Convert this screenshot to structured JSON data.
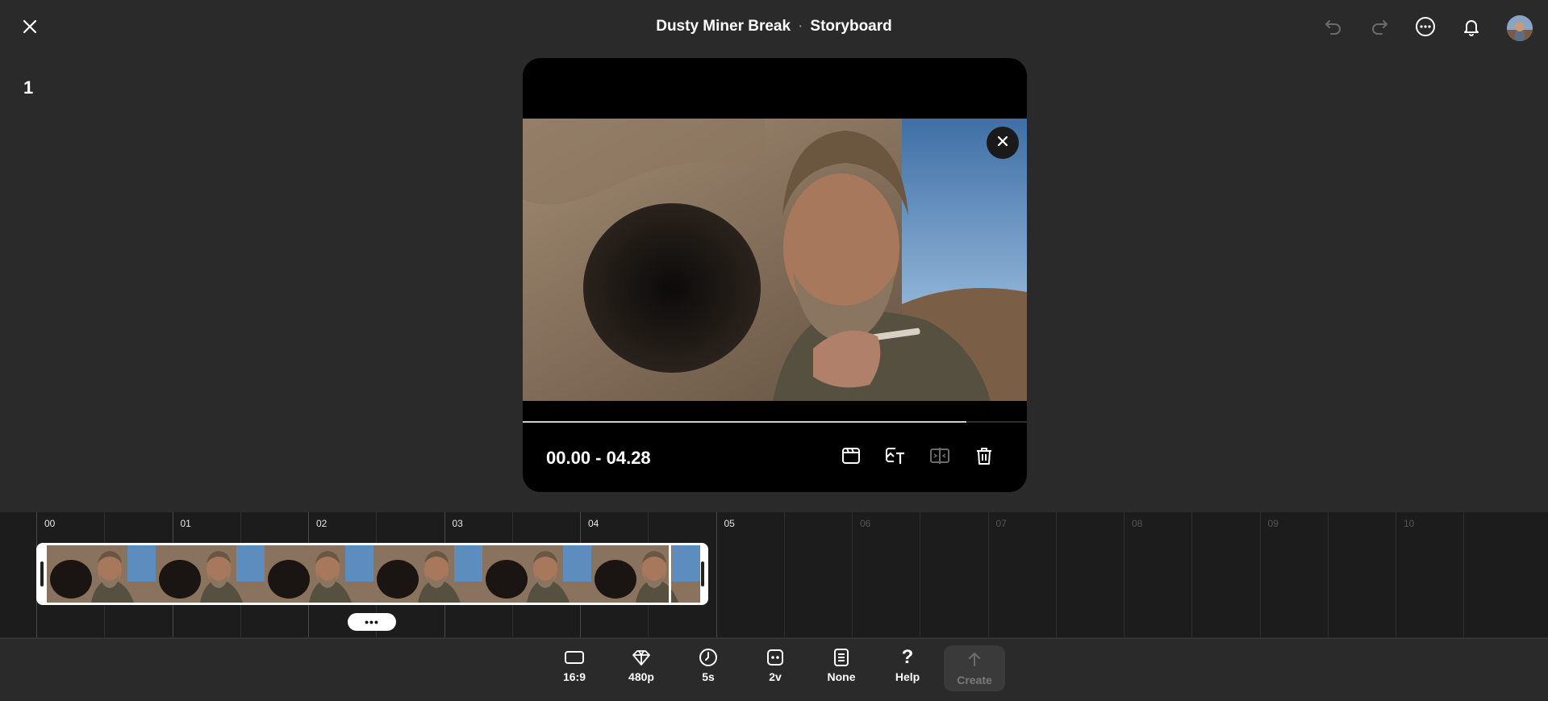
{
  "header": {
    "project_title": "Dusty Miner Break",
    "separator": "·",
    "section": "Storyboard"
  },
  "icons": {
    "close": "close-icon",
    "undo": "undo-icon",
    "redo": "redo-icon",
    "more": "more-options-icon",
    "notifications": "bell-icon",
    "avatar": "user-avatar"
  },
  "preview": {
    "scene_number": "1",
    "timecode": "00.00 - 04.28",
    "playback_progress": 0.88,
    "tools": [
      "storyboard-icon",
      "image-to-text-icon",
      "split-frame-icon",
      "trash-icon"
    ]
  },
  "timeline": {
    "ticks": [
      "00",
      "01",
      "02",
      "03",
      "04",
      "05",
      "06",
      "07",
      "08",
      "09",
      "10"
    ],
    "active_ticks": 6,
    "clip_frames": 6,
    "more_label": "•••"
  },
  "toolbar": {
    "items": [
      {
        "label": "16:9",
        "icon": "aspect-ratio-icon"
      },
      {
        "label": "480p",
        "icon": "diamond-quality-icon"
      },
      {
        "label": "5s",
        "icon": "clock-icon"
      },
      {
        "label": "2v",
        "icon": "variations-icon"
      },
      {
        "label": "None",
        "icon": "preset-icon"
      },
      {
        "label": "Help",
        "icon": "question-icon"
      }
    ],
    "create_label": "Create"
  },
  "colors": {
    "background": "#2a2a2a",
    "card": "#000000",
    "timeline": "#1c1c1c",
    "disabled_text": "#7a7a7a"
  }
}
